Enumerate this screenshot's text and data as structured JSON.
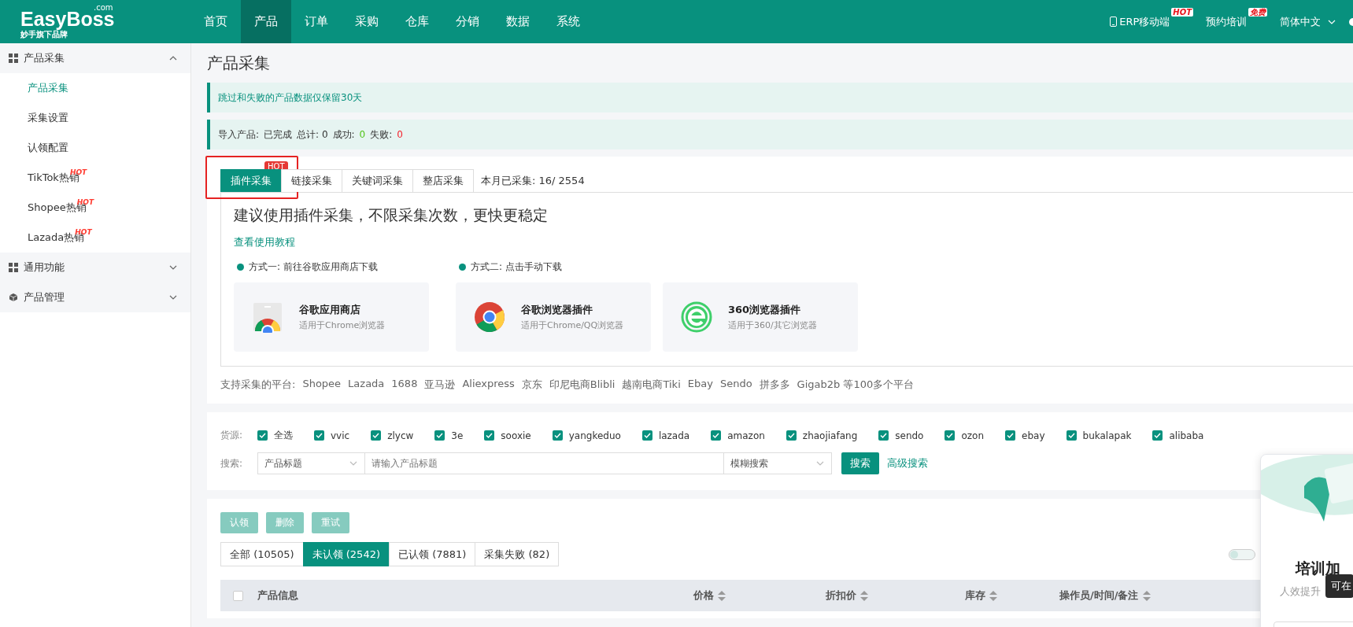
{
  "header": {
    "logo": "EasyBoss",
    "logo_suffix": ".com",
    "tagline": "妙手旗下品牌",
    "nav": [
      {
        "label": "首页",
        "selected": false
      },
      {
        "label": "产品",
        "selected": true
      },
      {
        "label": "订单",
        "selected": false
      },
      {
        "label": "采购",
        "selected": false
      },
      {
        "label": "仓库",
        "selected": false
      },
      {
        "label": "分销",
        "selected": false
      },
      {
        "label": "数据",
        "selected": false
      },
      {
        "label": "系统",
        "selected": false
      }
    ],
    "links": [
      {
        "kind": "mobile",
        "label": "ERP移动端",
        "badge": "HOT"
      },
      {
        "kind": "plain",
        "label": "预约培训",
        "badge": "免费"
      },
      {
        "kind": "dropdown",
        "label": "简体中文"
      }
    ]
  },
  "sidebar": {
    "groups": [
      {
        "label": "产品采集",
        "expanded": true,
        "children": [
          {
            "label": "产品采集",
            "selected": true
          },
          {
            "label": "采集设置",
            "selected": false
          },
          {
            "label": "认领配置",
            "selected": false
          },
          {
            "label": "TikTok热销",
            "badge": "HOT",
            "selected": false
          },
          {
            "label": "Shopee热销",
            "badge": "HOT",
            "selected": false
          },
          {
            "label": "Lazada热销",
            "badge": "HOT",
            "selected": false
          }
        ]
      },
      {
        "label": "通用功能",
        "expanded": false
      },
      {
        "label": "产品管理",
        "expanded": false
      }
    ]
  },
  "page_title": "产品采集",
  "notice": "跳过和失败的产品数据仅保留30天",
  "import_status": {
    "label": "导入产品:",
    "status": "已完成",
    "total": "总计: 0",
    "success_label": "成功:",
    "success": "0",
    "fail_label": "失败:",
    "fail": "0"
  },
  "collect": {
    "tabs": [
      {
        "label": "插件采集",
        "selected": true,
        "badge": "HOT",
        "highlighted": true
      },
      {
        "label": "链接采集",
        "selected": false
      },
      {
        "label": "关键词采集",
        "selected": false
      },
      {
        "label": "整店采集",
        "selected": false
      }
    ],
    "monthly": "本月已采集: 16/ 2554",
    "headline": "建议使用插件采集，不限采集次数，更快更稳定",
    "tutorial_link": "查看使用教程",
    "methods": [
      {
        "label": "方式一: 前往谷歌应用商店下载",
        "downloads": [
          {
            "title": "谷歌应用商店",
            "subtitle": "适用于Chrome浏览器"
          }
        ]
      },
      {
        "label": "方式二: 点击手动下载",
        "downloads": [
          {
            "title": "谷歌浏览器插件",
            "subtitle": "适用于Chrome/QQ浏览器"
          },
          {
            "title": "360浏览器插件",
            "subtitle": "适用于360/其它浏览器"
          }
        ]
      }
    ],
    "platforms_label": "支持采集的平台:",
    "platforms": [
      "Shopee",
      "Lazada",
      "1688",
      "亚马逊",
      "Aliexpress",
      "京东",
      "印尼电商Blibli",
      "越南电商Tiki",
      "Ebay",
      "Sendo",
      "拼多多",
      "Gigab2b 等100多个平台"
    ]
  },
  "filters": {
    "source_label": "货源:",
    "sources": [
      {
        "label": "全选",
        "checked": true
      },
      {
        "label": "vvic",
        "checked": true
      },
      {
        "label": "zlycw",
        "checked": true
      },
      {
        "label": "3e",
        "checked": true
      },
      {
        "label": "sooxie",
        "checked": true
      },
      {
        "label": "yangkeduo",
        "checked": true
      },
      {
        "label": "lazada",
        "checked": true
      },
      {
        "label": "amazon",
        "checked": true
      },
      {
        "label": "zhaojiafang",
        "checked": true
      },
      {
        "label": "sendo",
        "checked": true
      },
      {
        "label": "ozon",
        "checked": true
      },
      {
        "label": "ebay",
        "checked": true
      },
      {
        "label": "bukalapak",
        "checked": true
      },
      {
        "label": "alibaba",
        "checked": true
      }
    ],
    "search_label": "搜索:",
    "field_select": "产品标题",
    "placeholder": "请输入产品标题",
    "mode_select": "模糊搜索",
    "search_button": "搜索",
    "advanced_link": "高级搜索"
  },
  "table": {
    "actions": [
      {
        "label": "认领",
        "disabled": true
      },
      {
        "label": "删除",
        "disabled": true
      },
      {
        "label": "重试",
        "disabled": true
      }
    ],
    "status_tabs": [
      {
        "label": "全部 (10505)",
        "selected": false
      },
      {
        "label": "未认领 (2542)",
        "selected": true
      },
      {
        "label": "已认领 (7881)",
        "selected": false
      },
      {
        "label": "采集失败 (82)",
        "selected": false
      }
    ],
    "toggle_on": false,
    "select_all_checked": false,
    "columns": [
      {
        "label": "产品信息",
        "sortable": false
      },
      {
        "label": "价格",
        "sortable": true
      },
      {
        "label": "折扣价",
        "sortable": true
      },
      {
        "label": "库存",
        "sortable": true
      },
      {
        "label": "操作员/时间/备注",
        "sortable": true
      }
    ]
  },
  "promo": {
    "title": "培训加",
    "subtitle": "人效提升",
    "tooltip": "可在"
  }
}
